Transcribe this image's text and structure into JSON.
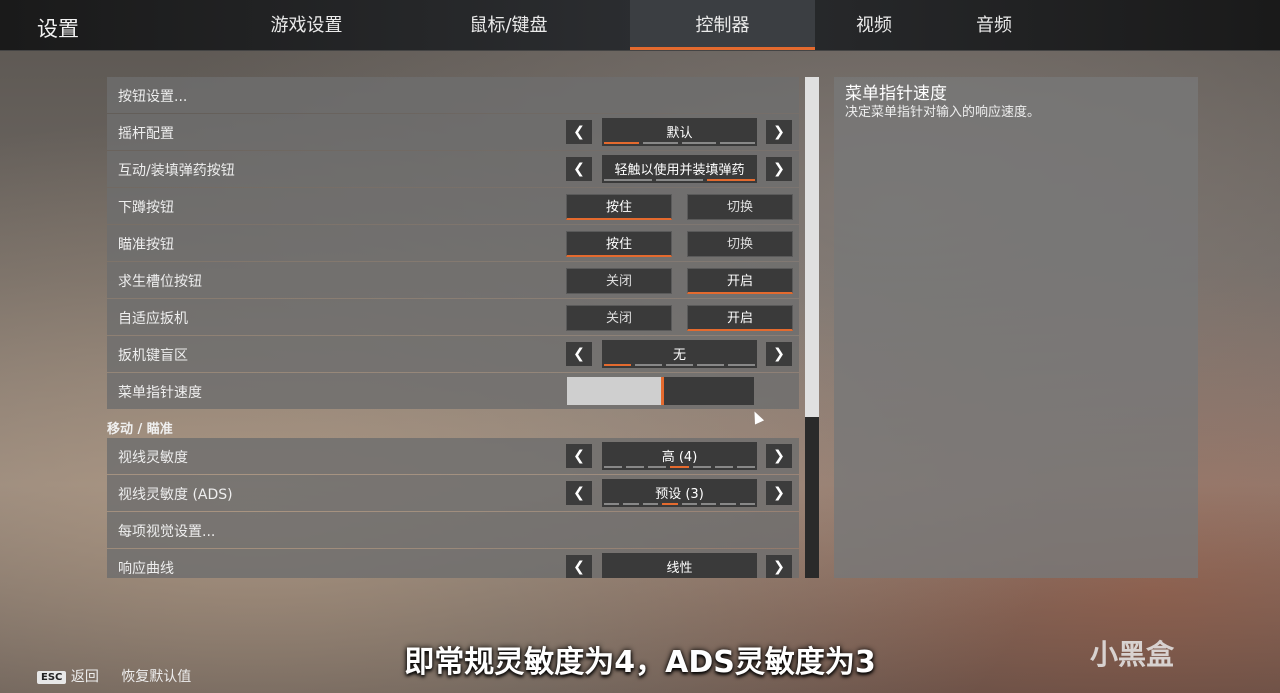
{
  "header": {
    "title": "设置",
    "tabs": [
      "游戏设置",
      "鼠标/键盘",
      "控制器",
      "视频",
      "音频"
    ]
  },
  "rows": {
    "button_config": "按钮设置...",
    "stick_config": {
      "label": "摇杆配置",
      "value": "默认"
    },
    "interact": {
      "label": "互动/装填弹药按钮",
      "value": "轻触以使用并装填弹药"
    },
    "crouch": {
      "label": "下蹲按钮",
      "opt1": "按住",
      "opt2": "切换"
    },
    "aim": {
      "label": "瞄准按钮",
      "opt1": "按住",
      "opt2": "切换"
    },
    "survival": {
      "label": "求生槽位按钮",
      "opt1": "关闭",
      "opt2": "开启"
    },
    "adaptive": {
      "label": "自适应扳机",
      "opt1": "关闭",
      "opt2": "开启"
    },
    "deadzone": {
      "label": "扳机键盲区",
      "value": "无"
    },
    "menu_speed": {
      "label": "菜单指针速度",
      "fill": 0.5
    },
    "section": "移动 / 瞄准",
    "look": {
      "label": "视线灵敏度",
      "value": "高 (4)"
    },
    "look_ads": {
      "label": "视线灵敏度 (ADS)",
      "value": "预设 (3)"
    },
    "per_optic": "每项视觉设置...",
    "curve": {
      "label": "响应曲线",
      "value": "线性"
    }
  },
  "description": {
    "title": "菜单指针速度",
    "text": "决定菜单指针对输入的响应速度。"
  },
  "footer": {
    "esc": "ESC",
    "back": "返回",
    "reset": "恢复默认值"
  },
  "subtitle": "即常规灵敏度为4，ADS灵敏度为3",
  "watermark": "小黑盒",
  "colors": {
    "accent": "#e46a2e"
  }
}
